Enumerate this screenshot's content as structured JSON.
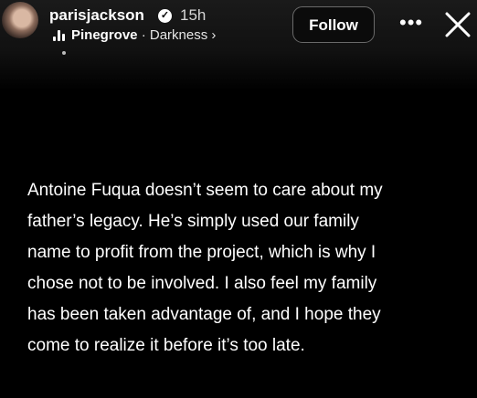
{
  "post": {
    "username": "parisjackson",
    "verified_mark": "✓",
    "time": "15h",
    "music": {
      "artist": "Pinegrove",
      "separator": "·",
      "track": "Darkness",
      "chevron": "›",
      "icon": "music-bars-icon"
    }
  },
  "actions": {
    "follow_label": "Follow",
    "more_label": "•••",
    "close_icon": "close-icon"
  },
  "caption": {
    "lines": [
      "Antoine Fuqua doesn’t seem to care about my",
      "father’s legacy. He’s simply used our family",
      "name to profit from the project, which is why I",
      "chose not to be involved. I also feel my family",
      "has been taken advantage of, and I hope they",
      "come to realize it before it’s too late."
    ]
  },
  "colors": {
    "background": "#000000",
    "text": "#ffffff",
    "muted": "#d6d6d6",
    "button_border": "#6a6a6a"
  }
}
